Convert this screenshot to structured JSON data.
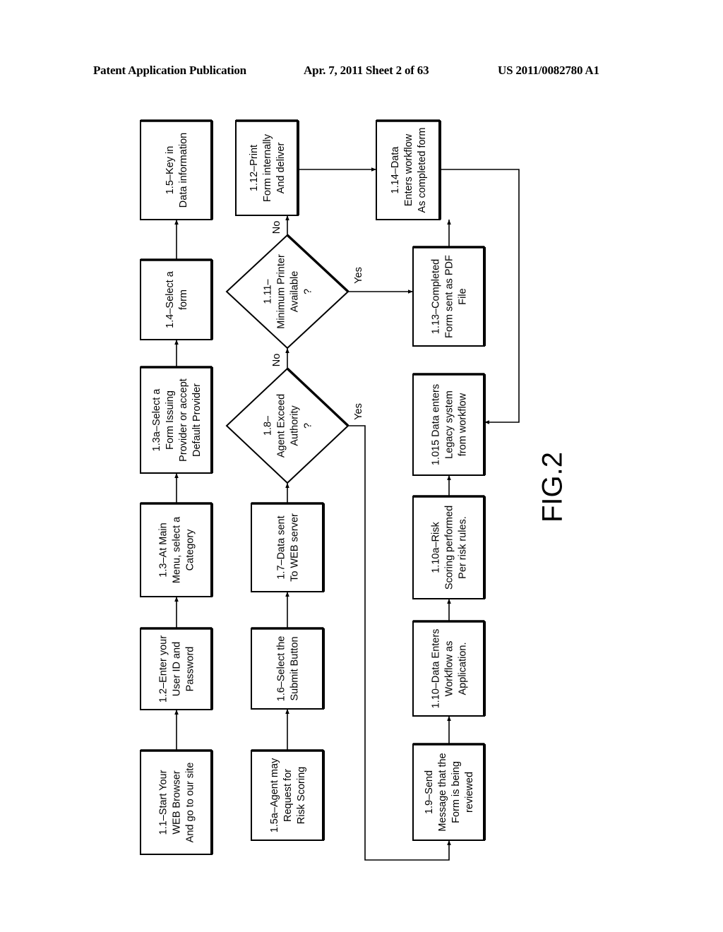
{
  "header": {
    "publication": "Patent Application Publication",
    "date_sheet": "Apr. 7, 2011   Sheet 2 of 63",
    "number": "US 2011/0082780 A1"
  },
  "figure_label": "FIG.2",
  "nodes": {
    "n1_1": {
      "type": "process",
      "lines": [
        "1.1–Start Your",
        "WEB Browser",
        "And go to our site"
      ]
    },
    "n1_2": {
      "type": "process",
      "lines": [
        "1.2–Enter your",
        "User ID and",
        "Password"
      ]
    },
    "n1_3": {
      "type": "process",
      "lines": [
        "1.3–At Main",
        "Menu, select a",
        "Category"
      ]
    },
    "n1_3a": {
      "type": "process",
      "lines": [
        "1.3a–Select a",
        "Form Issuing",
        "Provider or accept",
        "Default Provider"
      ]
    },
    "n1_4": {
      "type": "process",
      "lines": [
        "1.4–Select a",
        "form"
      ]
    },
    "n1_5": {
      "type": "process",
      "lines": [
        "1.5–Key in",
        "Data information"
      ]
    },
    "n1_5a": {
      "type": "process",
      "lines": [
        "1.5a–Agent may",
        "Request for",
        "Risk Scoring"
      ]
    },
    "n1_6": {
      "type": "process",
      "lines": [
        "1.6–Select the",
        "Submit Button"
      ]
    },
    "n1_7": {
      "type": "process",
      "lines": [
        "1.7–Data sent",
        "To WEB server"
      ]
    },
    "n1_8": {
      "type": "decision",
      "lines": [
        "1.8–",
        "Agent Exceed",
        "Authority",
        "?"
      ]
    },
    "n1_11": {
      "type": "decision",
      "lines": [
        "1.11–",
        "Minimum Printer",
        "Available",
        "?"
      ]
    },
    "n1_12": {
      "type": "process",
      "lines": [
        "1.12–Print",
        "Form internally",
        "And deliver"
      ]
    },
    "n1_9": {
      "type": "process",
      "lines": [
        "1.9–Send",
        "Message that the",
        "Form is being",
        "reviewed"
      ]
    },
    "n1_10": {
      "type": "process",
      "lines": [
        "1.10–Data Enters",
        "Workflow as",
        "Application."
      ]
    },
    "n1_10a": {
      "type": "process",
      "lines": [
        "1.10a–Risk",
        "Scoring performed",
        "Per risk rules."
      ]
    },
    "n1_015": {
      "type": "process",
      "lines": [
        "1.015 Data enters",
        "Legacy system",
        "from workflow"
      ]
    },
    "n1_13": {
      "type": "process",
      "lines": [
        "1.13–Completed",
        "Form sent as PDF",
        "File"
      ]
    },
    "n1_14": {
      "type": "process",
      "lines": [
        "1.14–Data",
        "Enters workflow",
        "As completed form"
      ]
    }
  },
  "edge_labels": {
    "n1_8_no": "No",
    "n1_8_yes": "Yes",
    "n1_11_no": "No",
    "n1_11_yes": "Yes"
  },
  "edges": [
    {
      "from": "n1_1",
      "to": "n1_2"
    },
    {
      "from": "n1_2",
      "to": "n1_3"
    },
    {
      "from": "n1_3",
      "to": "n1_3a"
    },
    {
      "from": "n1_3a",
      "to": "n1_4"
    },
    {
      "from": "n1_4",
      "to": "n1_5"
    },
    {
      "from": "n1_5a",
      "to": "n1_6"
    },
    {
      "from": "n1_6",
      "to": "n1_7"
    },
    {
      "from": "n1_7",
      "to": "n1_8"
    },
    {
      "from": "n1_8",
      "to": "n1_11",
      "label": "No"
    },
    {
      "from": "n1_8",
      "to": "n1_9",
      "label": "Yes"
    },
    {
      "from": "n1_11",
      "to": "n1_12",
      "label": "No"
    },
    {
      "from": "n1_11",
      "to": "n1_13",
      "label": "Yes"
    },
    {
      "from": "n1_12",
      "to": "n1_14"
    },
    {
      "from": "n1_13",
      "to": "n1_14"
    },
    {
      "from": "n1_14",
      "to": "n1_015"
    },
    {
      "from": "n1_9",
      "to": "n1_10"
    },
    {
      "from": "n1_10",
      "to": "n1_10a"
    },
    {
      "from": "n1_10a",
      "to": "n1_015"
    }
  ]
}
